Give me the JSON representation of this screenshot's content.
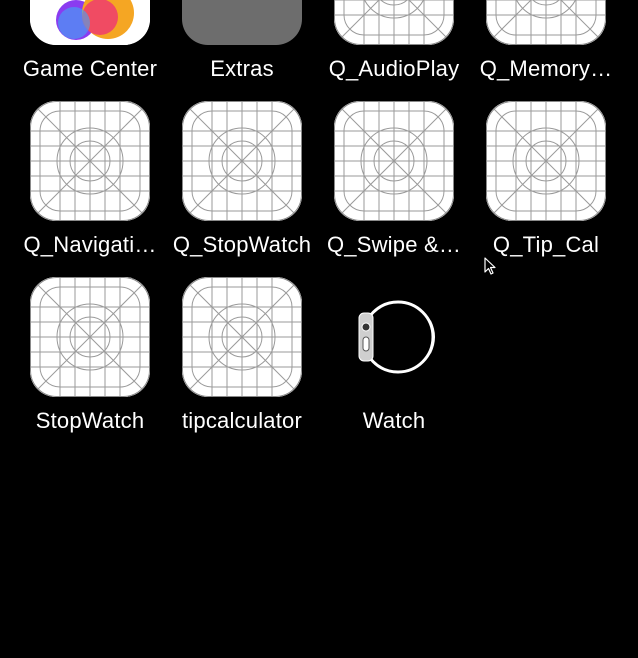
{
  "apps": [
    {
      "label": "Game Center",
      "icon": "game-center-icon"
    },
    {
      "label": "Extras",
      "icon": "extras-folder-icon"
    },
    {
      "label": "Q_AudioPlay",
      "icon": "placeholder-app-icon"
    },
    {
      "label": "Q_Memory…",
      "icon": "placeholder-app-icon"
    },
    {
      "label": "Q_Navigati…",
      "icon": "placeholder-app-icon"
    },
    {
      "label": "Q_StopWatch",
      "icon": "placeholder-app-icon"
    },
    {
      "label": "Q_Swipe &…",
      "icon": "placeholder-app-icon"
    },
    {
      "label": "Q_Tip_Cal",
      "icon": "placeholder-app-icon"
    },
    {
      "label": "StopWatch",
      "icon": "placeholder-app-icon"
    },
    {
      "label": "tipcalculator",
      "icon": "placeholder-app-icon"
    },
    {
      "label": "Watch",
      "icon": "watch-icon"
    }
  ],
  "colors": {
    "background": "#000000",
    "label": "#ffffff",
    "extras_folder": "#6d6d6d",
    "placeholder_grid": "#9a9a9a"
  }
}
